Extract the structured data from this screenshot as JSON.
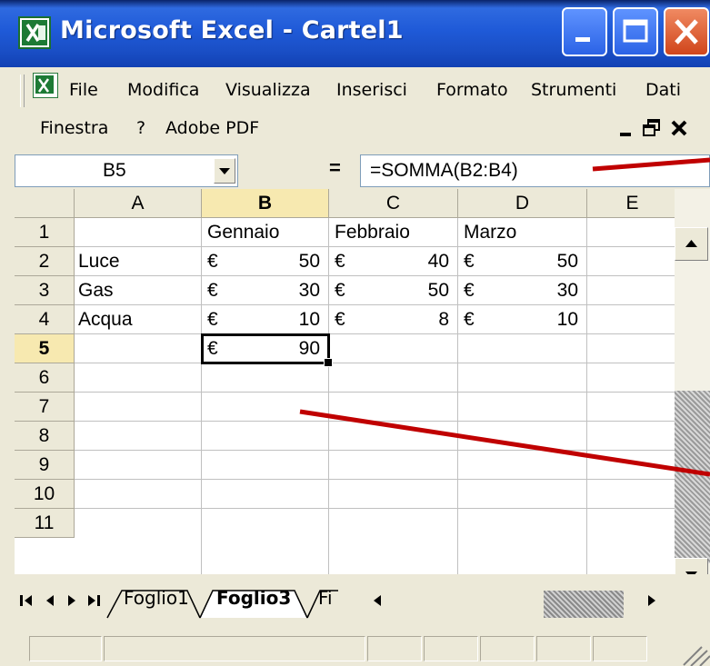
{
  "window": {
    "title": "Microsoft Excel - Cartel1"
  },
  "menu": {
    "items": [
      "File",
      "Modifica",
      "Visualizza",
      "Inserisci",
      "Formato",
      "Strumenti",
      "Dati"
    ],
    "items_row2": [
      "Finestra",
      "?",
      "Adobe PDF"
    ]
  },
  "formula_bar": {
    "name_box": "B5",
    "equals": "=",
    "formula": "=SOMMA(B2:B4)"
  },
  "sheet": {
    "columns": [
      "A",
      "B",
      "C",
      "D",
      "E"
    ],
    "rows": [
      "1",
      "2",
      "3",
      "4",
      "5",
      "6",
      "7",
      "8",
      "9",
      "10",
      "11"
    ],
    "active_cell": "B5",
    "header_row": [
      "",
      "Gennaio",
      "Febbraio",
      "Marzo"
    ],
    "data": [
      {
        "label": "Luce",
        "values": [
          [
            "€",
            "50"
          ],
          [
            "€",
            "40"
          ],
          [
            "€",
            "50"
          ]
        ]
      },
      {
        "label": "Gas",
        "values": [
          [
            "€",
            "30"
          ],
          [
            "€",
            "50"
          ],
          [
            "€",
            "30"
          ]
        ]
      },
      {
        "label": "Acqua",
        "values": [
          [
            "€",
            "10"
          ],
          [
            "€",
            "8"
          ],
          [
            "€",
            "10"
          ]
        ]
      }
    ],
    "total": [
      "€",
      "90"
    ]
  },
  "sheet_tabs": [
    "Foglio1",
    "Foglio3",
    "Fi"
  ],
  "active_tab": "Foglio3",
  "colors": {
    "title_bar": "#1f5ad8",
    "annotation_arrow": "#c00000",
    "active_header": "#f7e9b0"
  },
  "icons": [
    "excel-logo-icon",
    "minimize-icon",
    "maximize-icon",
    "close-icon",
    "dropdown-arrow-icon",
    "scroll-up-icon",
    "scroll-down-icon",
    "first-sheet-icon",
    "prev-sheet-icon",
    "next-sheet-icon",
    "last-sheet-icon"
  ]
}
